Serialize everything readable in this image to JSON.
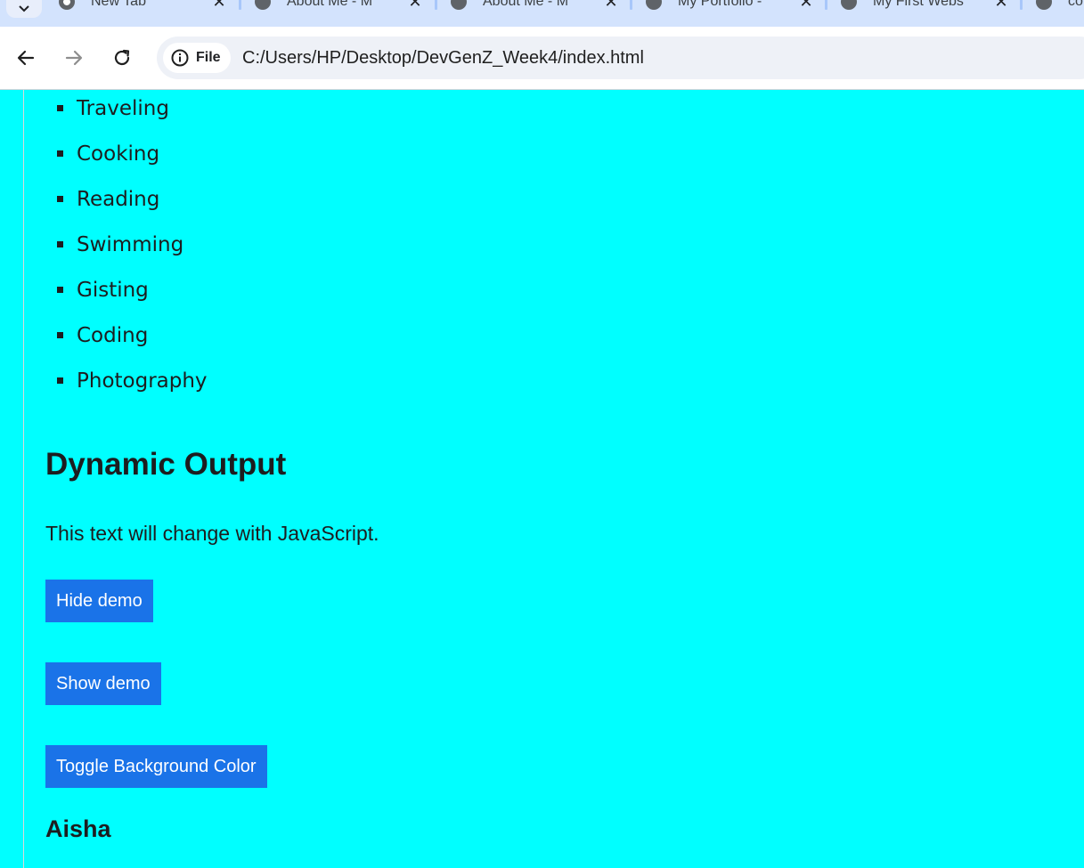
{
  "browser": {
    "tabs": [
      {
        "title": "New Tab",
        "icon": "chrome-icon"
      },
      {
        "title": "About Me - M",
        "icon": "globe-icon"
      },
      {
        "title": "About Me - M",
        "icon": "globe-icon"
      },
      {
        "title": "My Portfolio -",
        "icon": "globe-icon"
      },
      {
        "title": "My First Webs",
        "icon": "globe-icon"
      },
      {
        "title": "co",
        "icon": "globe-icon"
      }
    ],
    "security_chip": "File",
    "url": "C:/Users/HP/Desktop/DevGenZ_Week4/index.html"
  },
  "page": {
    "background": "#00ffff",
    "hobbies": [
      "Traveling",
      "Cooking",
      "Reading",
      "Swimming",
      "Gisting",
      "Coding",
      "Photography"
    ],
    "dynamic_title": "Dynamic Output",
    "dynamic_text": "This text will change with JavaScript.",
    "buttons": {
      "hide": "Hide demo",
      "show": "Show demo",
      "toggle": "Toggle Background Color"
    },
    "name": "Aisha"
  }
}
